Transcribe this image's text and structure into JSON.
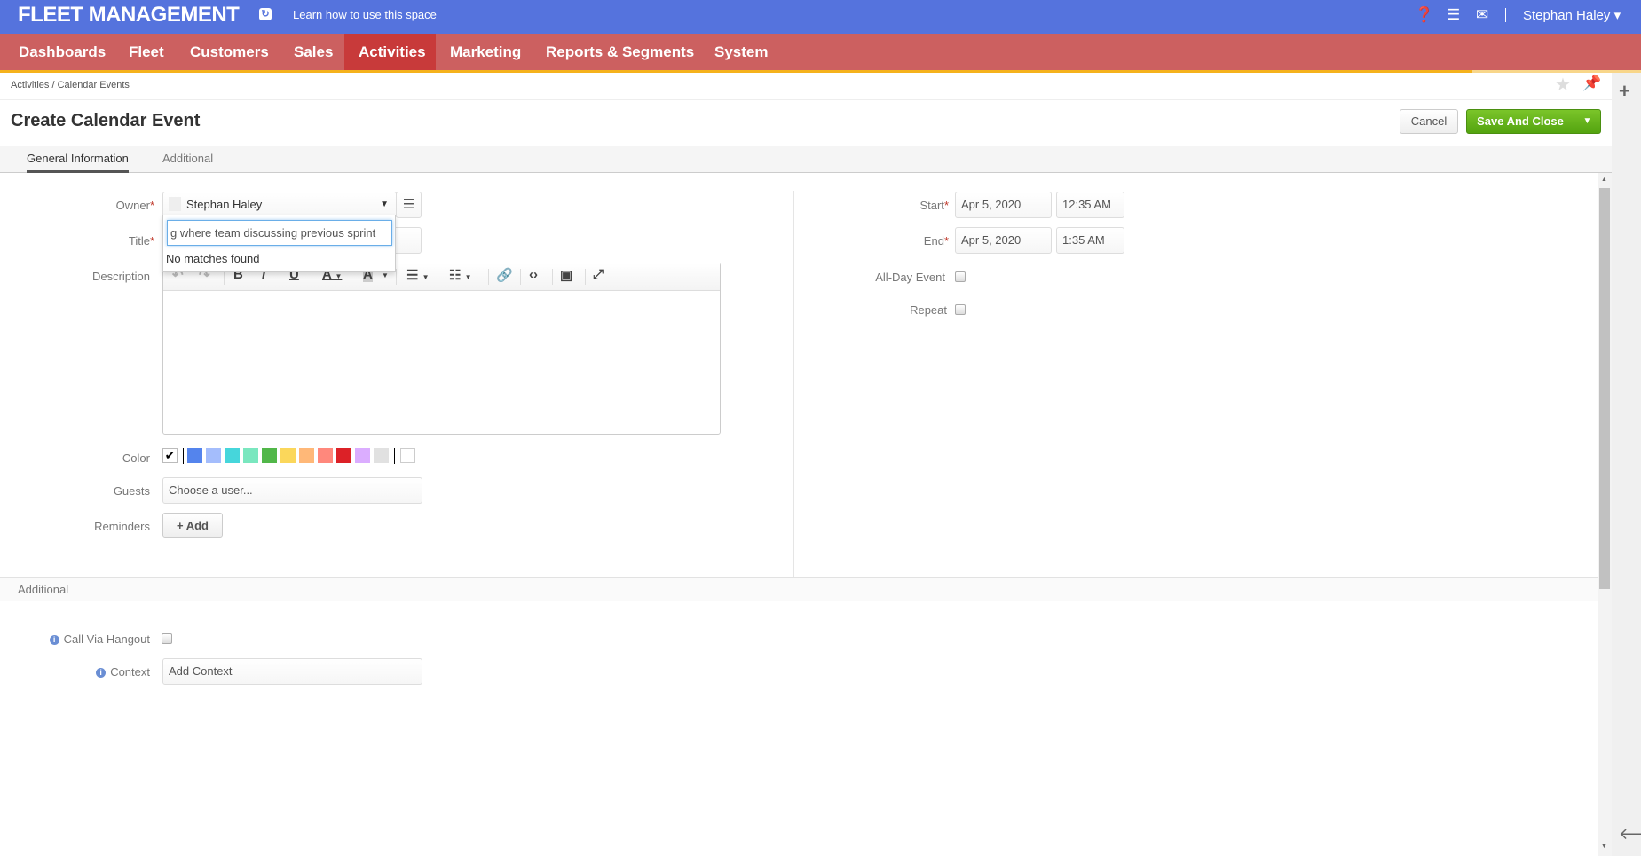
{
  "header": {
    "brand": "FLEET MANAGEMENT",
    "learn": "Learn how to use this space",
    "user": "Stephan Haley"
  },
  "nav": [
    {
      "label": "Dashboards"
    },
    {
      "label": "Fleet"
    },
    {
      "label": "Customers"
    },
    {
      "label": "Sales"
    },
    {
      "label": "Activities"
    },
    {
      "label": "Marketing"
    },
    {
      "label": "Reports & Segments"
    },
    {
      "label": "System"
    }
  ],
  "breadcrumb": "Activities / Calendar Events",
  "page_title": "Create Calendar Event",
  "actions": {
    "cancel": "Cancel",
    "save": "Save And Close"
  },
  "tabs": [
    "General Information",
    "Additional"
  ],
  "form": {
    "owner_label": "Owner",
    "owner_value": "Stephan Haley",
    "owner_search": "g where team discussing previous sprint",
    "no_matches": "No matches found",
    "title_label": "Title",
    "description_label": "Description",
    "color_label": "Color",
    "colors": [
      "#5484ed",
      "#a4bdfc",
      "#46d6db",
      "#7ae7bf",
      "#51b749",
      "#fbd75b",
      "#ffb878",
      "#ff887c",
      "#dc2127",
      "#dbadff",
      "#e1e1e1"
    ],
    "guests_label": "Guests",
    "guests_placeholder": "Choose a user...",
    "reminders_label": "Reminders",
    "add_label": "+ Add",
    "start_label": "Start",
    "start_date": "Apr 5, 2020",
    "start_time": "12:35 AM",
    "end_label": "End",
    "end_date": "Apr 5, 2020",
    "end_time": "1:35 AM",
    "allday_label": "All-Day Event",
    "repeat_label": "Repeat"
  },
  "additional": {
    "title": "Additional",
    "hangout_label": "Call Via Hangout",
    "context_label": "Context",
    "context_placeholder": "Add Context"
  }
}
